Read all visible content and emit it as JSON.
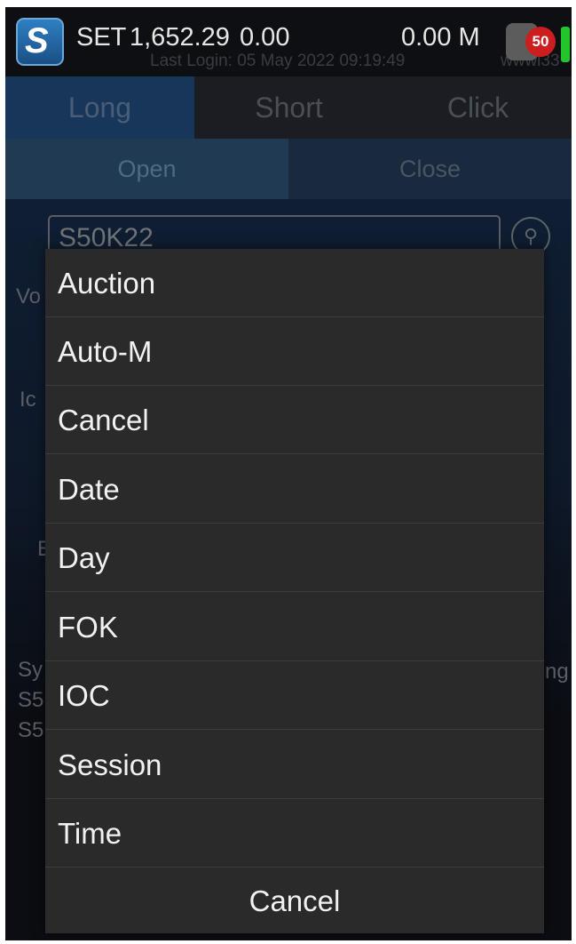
{
  "status": {
    "index_name": "SET",
    "index_value": "1,652.29",
    "change": "0.00",
    "volume": "0.00 M",
    "last_login": "Last Login: 05 May 2022 09:19:49",
    "user": "wwwi33",
    "notification_count": "50"
  },
  "tabs": [
    {
      "label": "Long",
      "active": true
    },
    {
      "label": "Short",
      "active": false
    },
    {
      "label": "Click",
      "active": false
    }
  ],
  "subtabs": [
    {
      "label": "Open",
      "active": true
    },
    {
      "label": "Close",
      "active": false
    }
  ],
  "form": {
    "symbol": "S50K22"
  },
  "background_fragments": {
    "volume_label_fragment": "Vo",
    "row_label_fragment": "Ic",
    "e_fragment": "E",
    "sy_fragment": "Sy",
    "s5_fragment_1": "S5",
    "s5_fragment_2": "S5",
    "ng_fragment": "ng"
  },
  "dialog": {
    "options": [
      "Auction",
      "Auto-M",
      "Cancel",
      "Date",
      "Day",
      "FOK",
      "IOC",
      "Session",
      "Time"
    ],
    "cancel_label": "Cancel"
  },
  "icons": {
    "logo": "app-logo-icon",
    "search": "search-icon",
    "battery": "battery-icon"
  },
  "colors": {
    "dialog_bg": "#2a2a2a",
    "active_tab": "#18365a",
    "badge": "#cc1e1e",
    "battery": "#22c62b"
  }
}
